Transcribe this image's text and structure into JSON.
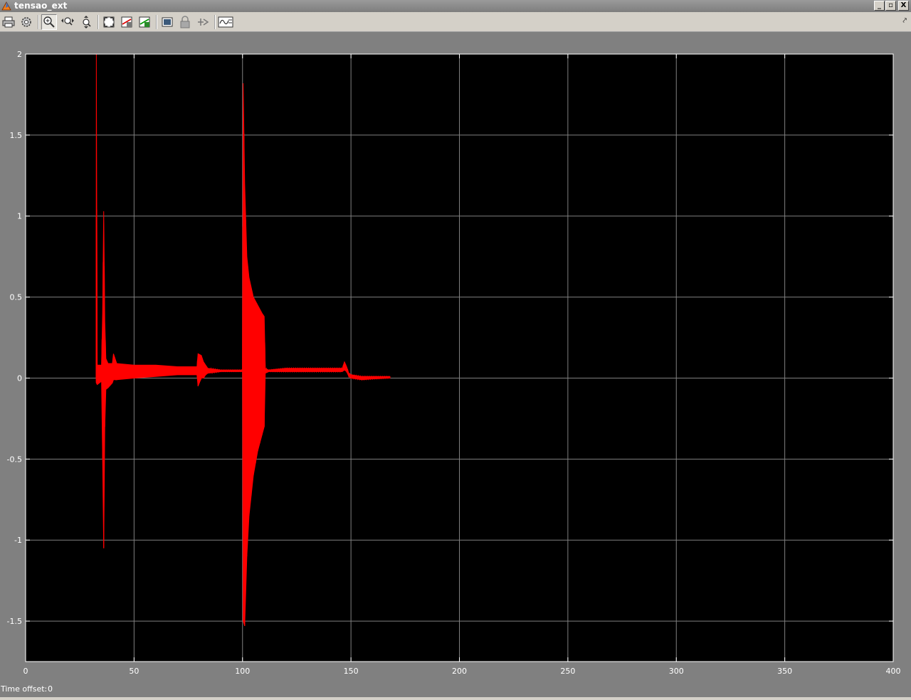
{
  "window": {
    "title": "tensao_ext",
    "controls": {
      "minimize": "_",
      "restore": "▫",
      "close": "X"
    }
  },
  "toolbar": {
    "buttons": [
      {
        "name": "print-icon",
        "icon": "printer"
      },
      {
        "name": "parameters-icon",
        "icon": "gear"
      },
      {
        "name": "zoom-icon",
        "icon": "magnifier",
        "active": true
      },
      {
        "name": "zoom-x-icon",
        "icon": "zoom-x-axis"
      },
      {
        "name": "zoom-y-icon",
        "icon": "zoom-y-axis"
      },
      {
        "name": "autoscale-icon",
        "icon": "autoscale"
      },
      {
        "name": "save-axes-icon",
        "icon": "save-axes-settings"
      },
      {
        "name": "restore-axes-icon",
        "icon": "restore-axes-settings"
      },
      {
        "name": "floating-scope-icon",
        "icon": "floating-scope"
      },
      {
        "name": "lock-axes-icon",
        "icon": "lock"
      },
      {
        "name": "signal-selection-icon",
        "icon": "signal-selector"
      },
      {
        "name": "legend-icon",
        "icon": "signal-legend"
      }
    ]
  },
  "status": {
    "time_offset_label": "Time offset:",
    "time_offset_value": "0"
  },
  "colors": {
    "trace": "#ff0000",
    "axes_bg": "#000000",
    "grid": "#808080",
    "figure_bg": "#808080",
    "text": "#ffffff"
  },
  "chart_data": {
    "type": "line",
    "title": "",
    "xlabel": "",
    "ylabel": "",
    "xlim": [
      0,
      400
    ],
    "ylim": [
      -1.75,
      2
    ],
    "xticks": [
      0,
      50,
      100,
      150,
      200,
      250,
      300,
      350,
      400
    ],
    "xtick_labels": [
      "0",
      "50",
      "100",
      "150",
      "200",
      "250",
      "300",
      "350",
      "400"
    ],
    "yticks": [
      -1.5,
      -1,
      -0.5,
      0,
      0.5,
      1,
      1.5,
      2
    ],
    "ytick_labels": [
      "-1.5",
      "-1",
      "-0.5",
      "0",
      "0.5",
      "1",
      "1.5",
      "2"
    ],
    "grid": true,
    "series": [
      {
        "color": "#ff0000",
        "envelope": [
          [
            32.5,
            0,
            0
          ],
          [
            32.6,
            -0.03,
            2.0
          ],
          [
            33,
            -0.04,
            0.08
          ],
          [
            35,
            -0.02,
            0.08
          ],
          [
            35.5,
            -0.5,
            0.4
          ],
          [
            36,
            -1.05,
            1.03
          ],
          [
            36.5,
            -0.3,
            0.35
          ],
          [
            37,
            -0.07,
            0.12
          ],
          [
            38,
            -0.06,
            0.09
          ],
          [
            40,
            -0.03,
            0.09
          ],
          [
            40.5,
            -0.01,
            0.15
          ],
          [
            42,
            -0.01,
            0.09
          ],
          [
            50,
            0.0,
            0.08
          ],
          [
            60,
            0.01,
            0.08
          ],
          [
            70,
            0.02,
            0.07
          ],
          [
            79,
            0.02,
            0.07
          ],
          [
            79.5,
            -0.05,
            0.15
          ],
          [
            81,
            0.0,
            0.14
          ],
          [
            82,
            0.0,
            0.1
          ],
          [
            83,
            0.02,
            0.08
          ],
          [
            84,
            0.03,
            0.06
          ],
          [
            90,
            0.04,
            0.05
          ],
          [
            100,
            0.04,
            0.05
          ],
          [
            100.3,
            -1.5,
            1.82
          ],
          [
            101,
            -1.53,
            1.2
          ],
          [
            102,
            -1.1,
            0.75
          ],
          [
            103,
            -0.85,
            0.62
          ],
          [
            105,
            -0.6,
            0.5
          ],
          [
            107,
            -0.45,
            0.45
          ],
          [
            109,
            -0.35,
            0.4
          ],
          [
            110,
            -0.3,
            0.38
          ],
          [
            110.5,
            0.03,
            0.06
          ],
          [
            112,
            0.04,
            0.05
          ],
          [
            120,
            0.04,
            0.06
          ],
          [
            130,
            0.04,
            0.06
          ],
          [
            140,
            0.04,
            0.06
          ],
          [
            146,
            0.04,
            0.06
          ],
          [
            147,
            0.05,
            0.1
          ],
          [
            148,
            0.04,
            0.07
          ],
          [
            149,
            0.01,
            0.03
          ],
          [
            150,
            0.0,
            0.02
          ],
          [
            155,
            -0.01,
            0.01
          ],
          [
            160,
            -0.005,
            0.01
          ],
          [
            168,
            0.0,
            0.01
          ]
        ]
      }
    ]
  }
}
